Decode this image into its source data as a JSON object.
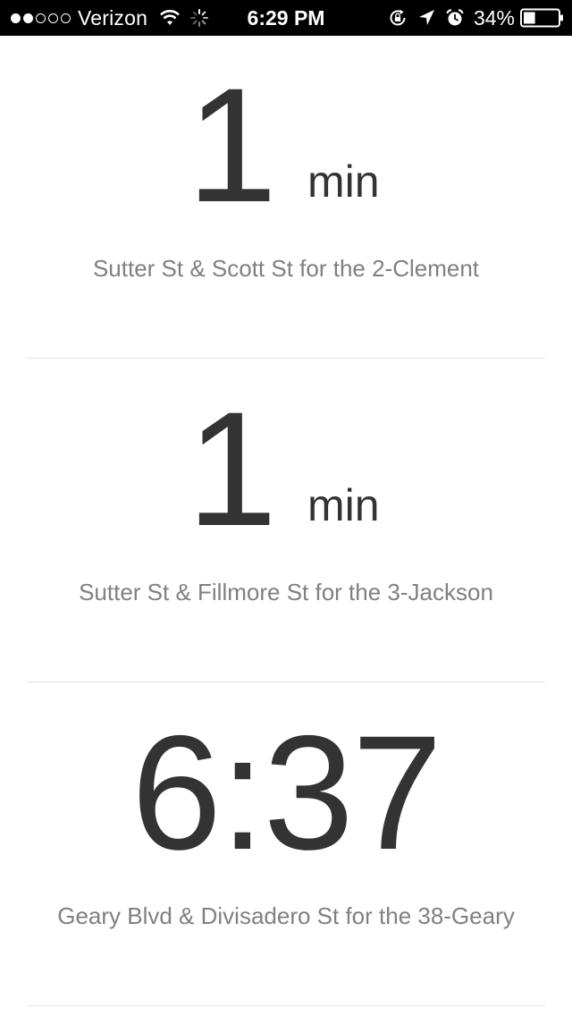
{
  "status_bar": {
    "signal_bars_filled": 2,
    "signal_bars_total": 5,
    "carrier": "Verizon",
    "time": "6:29 PM",
    "battery_percent": "34%",
    "battery_level": 0.34,
    "icons": [
      "wifi-icon",
      "activity-spinner-icon",
      "rotation-lock-icon",
      "location-arrow-icon",
      "alarm-clock-icon",
      "battery-icon"
    ]
  },
  "predictions": [
    {
      "value": "1",
      "unit": "min",
      "stop": "Sutter St & Scott St for the 2-Clement"
    },
    {
      "value": "1",
      "unit": "min",
      "stop": "Sutter St & Fillmore St for the 3-Jackson"
    },
    {
      "value": "6:37",
      "unit": "",
      "stop": "Geary Blvd & Divisadero St for the 38-Geary"
    }
  ],
  "colors": {
    "status_bar_bg": "#000000",
    "big_text": "#333333",
    "stop_text": "#808080",
    "divider": "#e4e4e4"
  }
}
